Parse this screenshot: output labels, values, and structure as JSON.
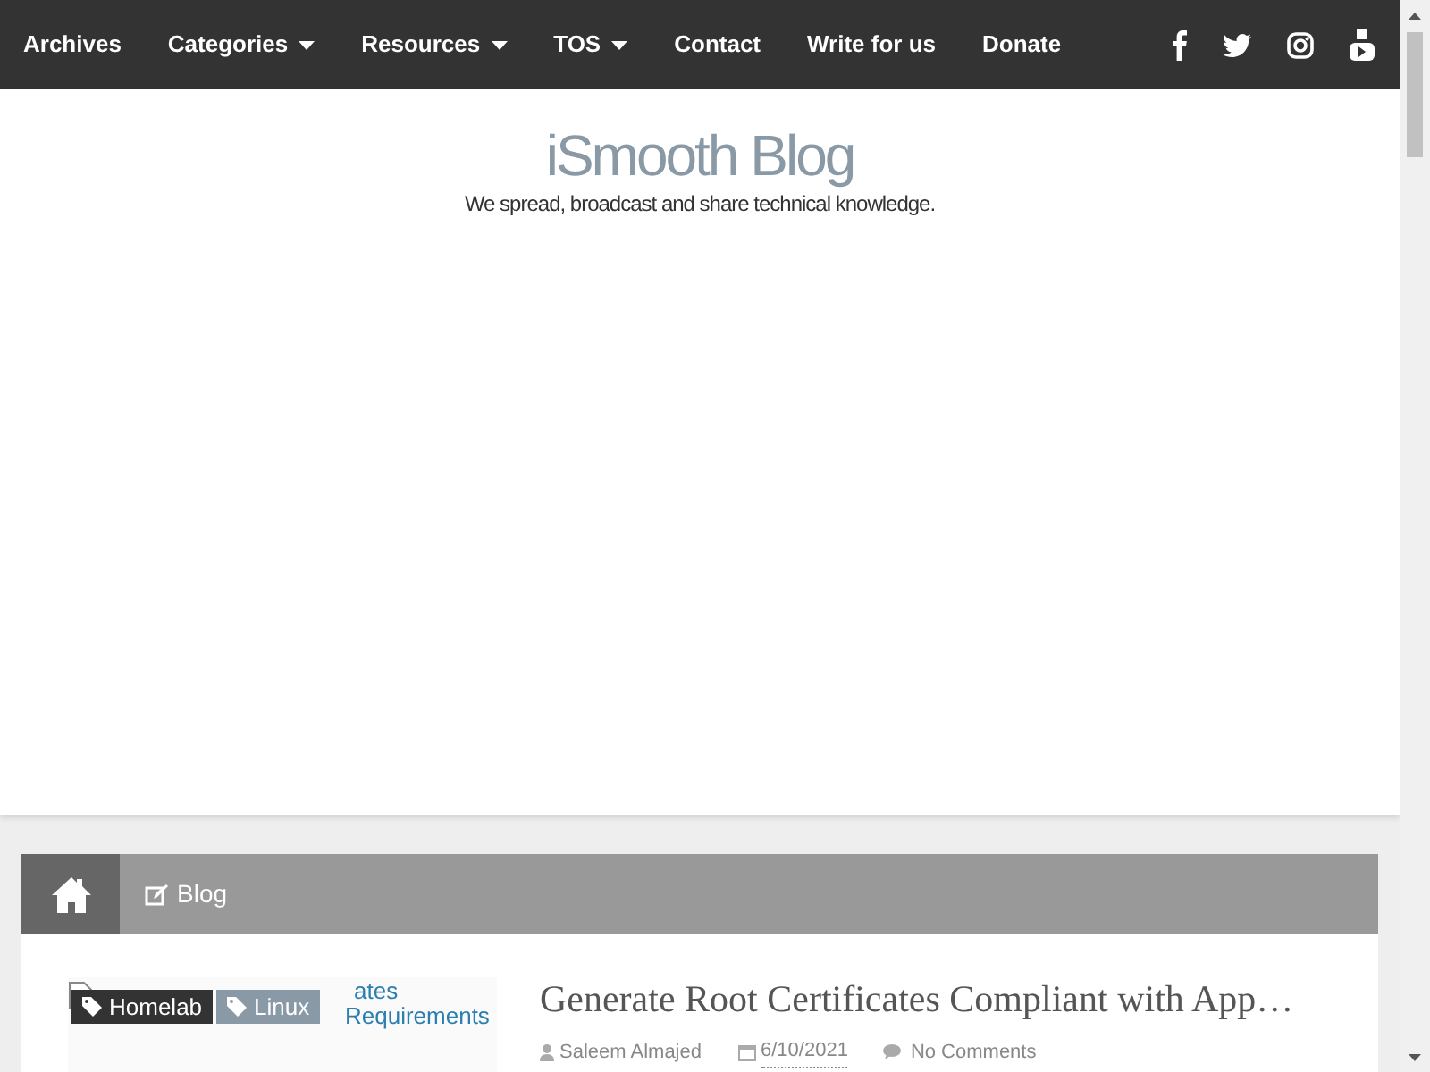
{
  "nav": {
    "items": [
      {
        "label": "Archives",
        "dropdown": false
      },
      {
        "label": "Categories",
        "dropdown": true
      },
      {
        "label": "Resources",
        "dropdown": true
      },
      {
        "label": "TOS",
        "dropdown": true
      },
      {
        "label": "Contact",
        "dropdown": false
      },
      {
        "label": "Write for us",
        "dropdown": false
      },
      {
        "label": "Donate",
        "dropdown": false
      }
    ],
    "social": [
      {
        "kind": "facebook"
      },
      {
        "kind": "twitter"
      },
      {
        "kind": "instagram"
      },
      {
        "kind": "youtube"
      }
    ]
  },
  "header": {
    "title": "iSmooth Blog",
    "tagline": "We spread, broadcast and share technical knowledge."
  },
  "breadcrumb": {
    "label": "Blog"
  },
  "post": {
    "image_alt_fragments": [
      "ates",
      "Requirements"
    ],
    "tags": [
      {
        "label": "Homelab",
        "color": "#333333"
      },
      {
        "label": "Linux",
        "color": "#8a99a6"
      }
    ],
    "title": "Generate Root Certificates Compliant with App…",
    "author": "Saleem Almajed",
    "date": "6/10/2021",
    "comments": "No Comments"
  }
}
